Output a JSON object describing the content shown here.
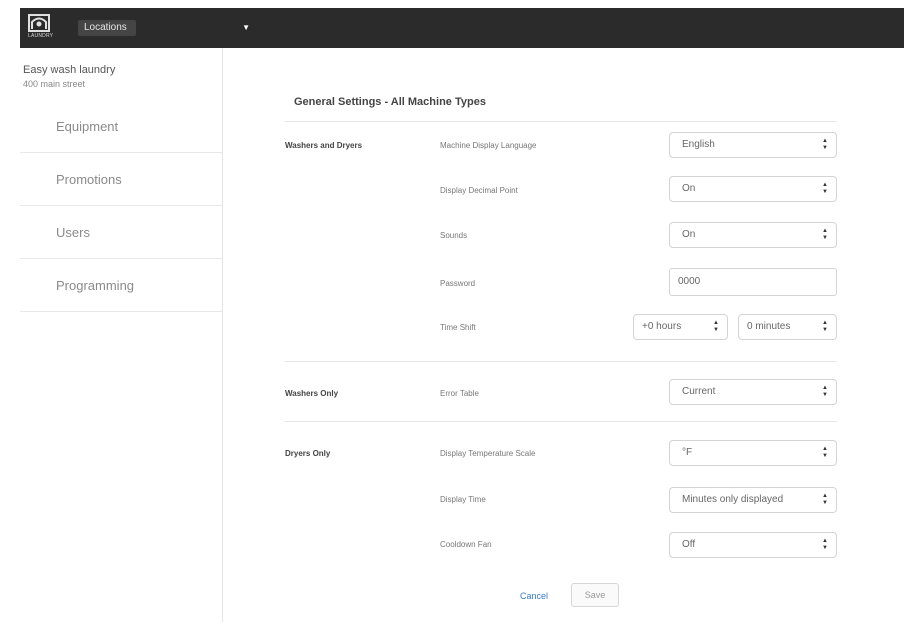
{
  "topbar": {
    "logo_text": "LAUNDRY",
    "location_select": "Locations"
  },
  "sidebar": {
    "site_name": "Easy wash laundry",
    "site_address": "400 main street",
    "items": [
      {
        "label": "Equipment"
      },
      {
        "label": "Promotions"
      },
      {
        "label": "Users"
      },
      {
        "label": "Programming"
      }
    ]
  },
  "main": {
    "title": "General Settings - All Machine Types",
    "groups": {
      "washers_dryers": "Washers and Dryers",
      "washers_only": "Washers Only",
      "dryers_only": "Dryers Only"
    },
    "fields": {
      "language": {
        "label": "Machine Display Language",
        "value": "English"
      },
      "decimal": {
        "label": "Display Decimal Point",
        "value": "On"
      },
      "sounds": {
        "label": "Sounds",
        "value": "On"
      },
      "password": {
        "label": "Password",
        "value": "0000"
      },
      "time_shift": {
        "label": "Time Shift",
        "hours": "+0 hours",
        "minutes": "0 minutes"
      },
      "error_table": {
        "label": "Error Table",
        "value": "Current"
      },
      "temp_scale": {
        "label": "Display Temperature Scale",
        "value": "°F"
      },
      "display_time": {
        "label": "Display Time",
        "value": "Minutes only displayed"
      },
      "cooldown_fan": {
        "label": "Cooldown Fan",
        "value": "Off"
      }
    },
    "actions": {
      "cancel": "Cancel",
      "save": "Save"
    }
  }
}
